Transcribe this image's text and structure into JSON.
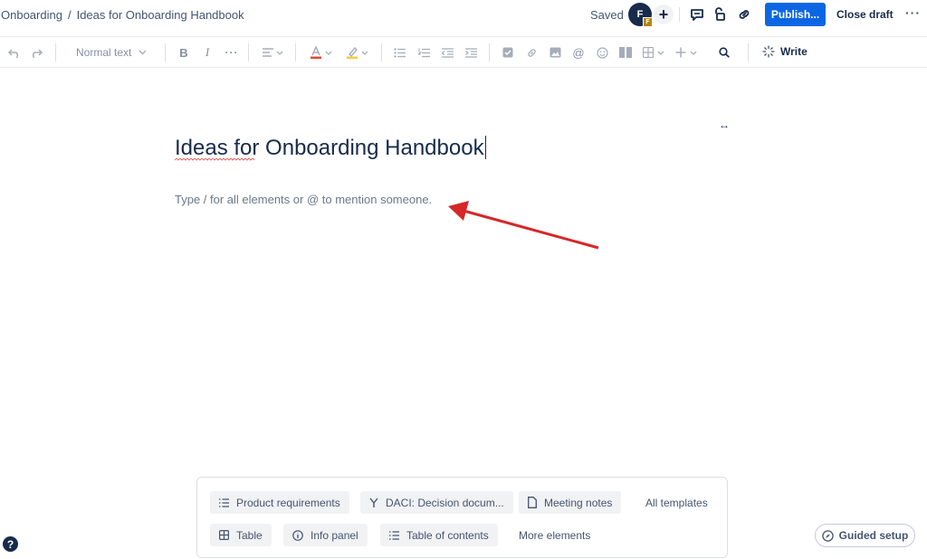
{
  "header": {
    "breadcrumb": [
      "Onboarding",
      "/",
      "Ideas for Onboarding Handbook"
    ],
    "saved_status": "Saved",
    "avatar_initial": "F",
    "avatar_badge": "F",
    "add_collaborator_symbol": "+",
    "publish_label": "Publish...",
    "close_draft_label": "Close draft",
    "more_symbol": "···",
    "icons": [
      "comment-icon",
      "restrictions-icon",
      "link-icon"
    ],
    "publish_color": "#0c66e4"
  },
  "toolbar": {
    "text_style": "Normal text",
    "icons": [
      "undo-icon",
      "redo-icon",
      "bold-icon",
      "italic-icon",
      "more-formatting-icon",
      "align-icon",
      "text-color-icon",
      "highlight-icon",
      "bullet-list-icon",
      "numbered-list-icon",
      "outdent-icon",
      "indent-icon",
      "task-icon",
      "link-icon",
      "image-icon",
      "mention-icon",
      "emoji-icon",
      "layout-icon",
      "table-icon",
      "insert-icon",
      "search-icon",
      "ai-write-icon"
    ],
    "write_label": "Write"
  },
  "editor": {
    "expand_symbol": "↔",
    "title": "Ideas for Onboarding Handbook",
    "placeholder": "Type / for all elements or @ to mention someone."
  },
  "templates": {
    "row1": [
      "Product requirements",
      "DACI: Decision docum...",
      "Meeting notes",
      "All templates"
    ],
    "row2": [
      "Table",
      "Info panel",
      "Table of contents",
      "More elements"
    ]
  },
  "footer": {
    "help_symbol": "?",
    "guided_setup_label": "Guided setup"
  },
  "annotation_color": "#d62727"
}
